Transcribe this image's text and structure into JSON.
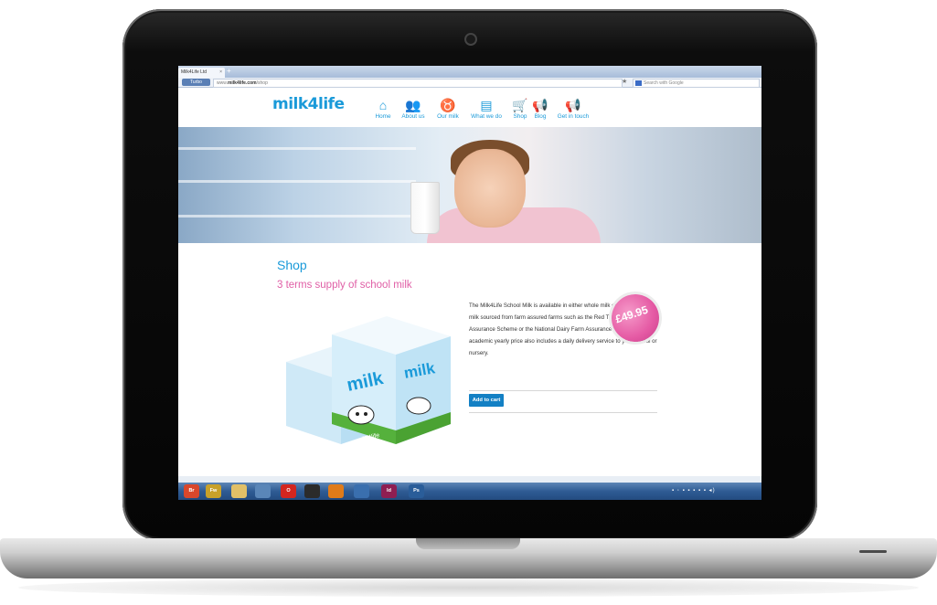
{
  "browser": {
    "tab_title": "Milk4Life Ltd",
    "tab_close": "×",
    "new_tab": "+",
    "turbo_label": "Turbo",
    "url_prefix": "www.",
    "url_domain": "milk4life.com",
    "url_path": "/shop",
    "star": "★",
    "search_placeholder": "Search with Google"
  },
  "site": {
    "logo": "milk4life",
    "nav": [
      {
        "label": "Home",
        "icon": "house-icon",
        "glyph": "⌂"
      },
      {
        "label": "About us",
        "icon": "people-icon",
        "glyph": "👥"
      },
      {
        "label": "Our milk",
        "icon": "cow-icon",
        "glyph": "♉"
      },
      {
        "label": "What we do",
        "icon": "document-icon",
        "glyph": "▤"
      },
      {
        "label": "Shop",
        "icon": "cart-icon",
        "glyph": "🛒"
      },
      {
        "label": "Blog",
        "icon": "megaphone-icon",
        "glyph": "📢"
      },
      {
        "label": "Get in touch",
        "icon": "megaphone-icon",
        "glyph": "📢"
      }
    ]
  },
  "page": {
    "title": "Shop",
    "subtitle": "3 terms supply of school milk",
    "description": "The Milk4Life School Milk is available in either whole milk or semi skimmed milk sourced from farm assured farms such as the Red Tractor Farm Assurance Scheme or the National Dairy Farm Assurance Scheme. The academic yearly price also includes a daily delivery service to your school or nursery.",
    "price": "£49.95",
    "add_to_cart": "Add to cart",
    "carton_text": "milk",
    "carton_brand": "milk4life"
  },
  "taskbar": {
    "apps": [
      {
        "label": "Br",
        "color": "#d9472b"
      },
      {
        "label": "Fw",
        "color": "#c8a12a"
      },
      {
        "label": "",
        "color": "#e2c067"
      },
      {
        "label": "",
        "color": "#5a86b8"
      },
      {
        "label": "O",
        "color": "#d3261f"
      },
      {
        "label": "",
        "color": "#2b2b2b"
      },
      {
        "label": "",
        "color": "#e07b19"
      },
      {
        "label": "",
        "color": "#3a6fae"
      },
      {
        "label": "Id",
        "color": "#8e1e52"
      },
      {
        "label": "Ps",
        "color": "#2a5d99"
      }
    ]
  },
  "colors": {
    "brand_blue": "#1a9ad9",
    "accent_pink": "#e05fa6",
    "button_blue": "#1380c4"
  }
}
